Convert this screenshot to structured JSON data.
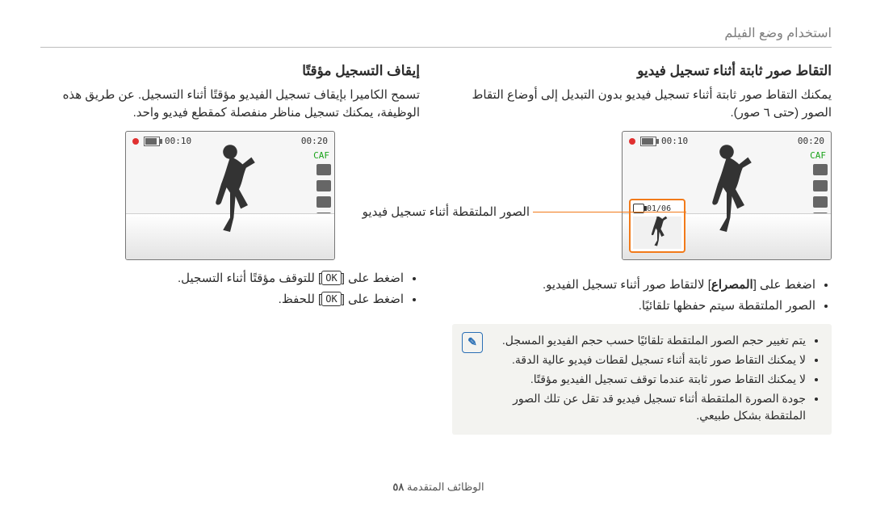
{
  "header": "استخدام وضع الفيلم",
  "right_col": {
    "title": "إيقاف التسجيل مؤقتًا",
    "para": "تسمح الكاميرا بإيقاف تسجيل الفيديو مؤقتًا أثناء التسجيل. عن طريق هذه الوظيفة، يمكنك تسجيل مناظر منفصلة كمقطع فيديو واحد.",
    "cam": {
      "time_elapsed": "00:10",
      "time_remaining": "00:20",
      "caf": "CAF"
    },
    "steps": [
      "اضغط على [‎OK‎] للتوقف مؤقتًا أثناء التسجيل.",
      "اضغط على [‎OK‎] للحفظ."
    ],
    "ok_label": "OK"
  },
  "left_col": {
    "title": "التقاط صور ثابتة أثناء تسجيل فيديو",
    "para": "يمكنك التقاط صور ثابتة أثناء تسجيل فيديو بدون التبديل إلى أوضاع التقاط الصور (حتى ٦ صور).",
    "cam": {
      "time_elapsed": "00:10",
      "time_remaining": "00:20",
      "caf": "CAF",
      "thumb_counter": "01/06"
    },
    "callout": "الصور الملتقطة أثناء تسجيل فيديو",
    "steps": [
      "اضغط على [المصراع] لالتقاط صور أثناء تسجيل الفيديو.",
      "الصور الملتقطة سيتم حفظها تلقائيًا."
    ],
    "shutter_label": "المصراع",
    "note": [
      "يتم تغيير حجم الصور الملتقطة تلقائيًا حسب حجم الفيديو المسجل.",
      "لا يمكنك التقاط صور ثابتة أثناء تسجيل لقطات فيديو عالية الدقة.",
      "لا يمكنك التقاط صور ثابتة عندما توقف تسجيل الفيديو مؤقتًا.",
      "جودة الصورة الملتقطة أثناء تسجيل فيديو قد تقل عن تلك الصور الملتقطة بشكل طبيعي."
    ]
  },
  "footer": {
    "section": "الوظائف المتقدمة",
    "page": "٥٨"
  }
}
